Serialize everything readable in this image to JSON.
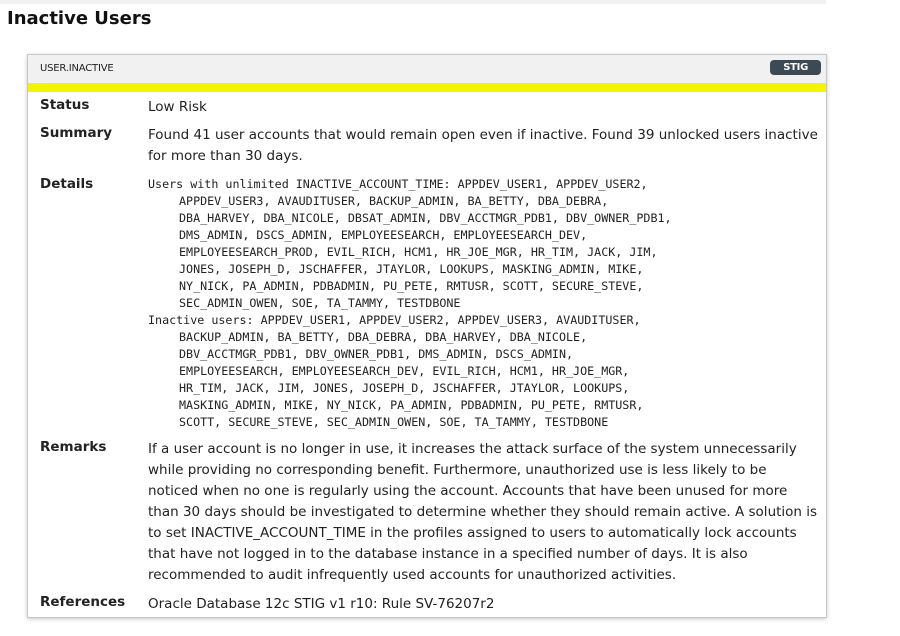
{
  "page": {
    "title": "Inactive Users"
  },
  "card": {
    "id": "USER.INACTIVE",
    "badge": "STIG",
    "stripe_color": "#f4f400"
  },
  "rows": {
    "status": {
      "label": "Status",
      "value": "Low Risk"
    },
    "summary": {
      "label": "Summary",
      "value": "Found 41 user accounts that would remain open even if inactive. Found 39 unlocked users inactive for more than 30 days."
    },
    "details": {
      "label": "Details",
      "lines": [
        "Users with unlimited INACTIVE_ACCOUNT_TIME: APPDEV_USER1, APPDEV_USER2,",
        "APPDEV_USER3, AVAUDITUSER, BACKUP_ADMIN, BA_BETTY, DBA_DEBRA,",
        "DBA_HARVEY, DBA_NICOLE, DBSAT_ADMIN, DBV_ACCTMGR_PDB1, DBV_OWNER_PDB1,",
        "DMS_ADMIN, DSCS_ADMIN, EMPLOYEESEARCH, EMPLOYEESEARCH_DEV,",
        "EMPLOYEESEARCH_PROD, EVIL_RICH, HCM1, HR_JOE_MGR, HR_TIM, JACK, JIM,",
        "JONES, JOSEPH_D, JSCHAFFER, JTAYLOR, LOOKUPS, MASKING_ADMIN, MIKE,",
        "NY_NICK, PA_ADMIN, PDBADMIN, PU_PETE, RMTUSR, SCOTT, SECURE_STEVE,",
        "SEC_ADMIN_OWEN, SOE, TA_TAMMY, TESTDBONE",
        "Inactive users: APPDEV_USER1, APPDEV_USER2, APPDEV_USER3, AVAUDITUSER,",
        "BACKUP_ADMIN, BA_BETTY, DBA_DEBRA, DBA_HARVEY, DBA_NICOLE,",
        "DBV_ACCTMGR_PDB1, DBV_OWNER_PDB1, DMS_ADMIN, DSCS_ADMIN,",
        "EMPLOYEESEARCH, EMPLOYEESEARCH_DEV, EVIL_RICH, HCM1, HR_JOE_MGR,",
        "HR_TIM, JACK, JIM, JONES, JOSEPH_D, JSCHAFFER, JTAYLOR, LOOKUPS,",
        "MASKING_ADMIN, MIKE, NY_NICK, PA_ADMIN, PDBADMIN, PU_PETE, RMTUSR,",
        "SCOTT, SECURE_STEVE, SEC_ADMIN_OWEN, SOE, TA_TAMMY, TESTDBONE"
      ]
    },
    "remarks": {
      "label": "Remarks",
      "value": "If a user account is no longer in use, it increases the attack surface of the system unnecessarily while providing no corresponding benefit. Furthermore, unauthorized use is less likely to be noticed when no one is regularly using the account. Accounts that have been unused for more than 30 days should be investigated to determine whether they should remain active. A solution is to set INACTIVE_ACCOUNT_TIME in the profiles assigned to users to automatically lock accounts that have not logged in to the database instance in a specified number of days. It is also recommended to audit infrequently used accounts for unauthorized activities."
    },
    "references": {
      "label": "References",
      "value": "Oracle Database 12c STIG v1 r10: Rule SV-76207r2"
    }
  }
}
